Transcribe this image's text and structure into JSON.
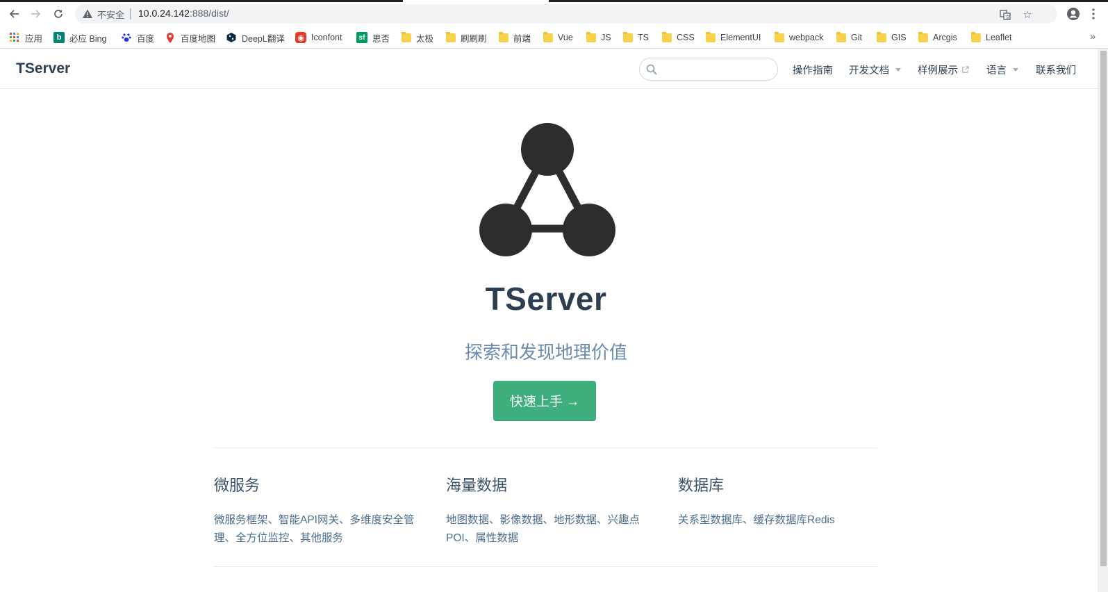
{
  "browser": {
    "security_label": "不安全",
    "url_host": "10.0.24.142",
    "url_path": ":888/dist/",
    "bookmarks": [
      {
        "label": "应用",
        "icon": "apps-grid-icon"
      },
      {
        "label": "必应 Bing",
        "icon": "bing-icon"
      },
      {
        "label": "百度",
        "icon": "baidu-paw-icon"
      },
      {
        "label": "百度地图",
        "icon": "map-pin-icon"
      },
      {
        "label": "DeepL翻译",
        "icon": "deepl-icon"
      },
      {
        "label": "Iconfont",
        "icon": "iconfont-icon"
      },
      {
        "label": "思否",
        "icon": "segmentfault-icon"
      },
      {
        "label": "太极",
        "icon": "folder-icon"
      },
      {
        "label": "刷刷刷",
        "icon": "folder-icon"
      },
      {
        "label": "前端",
        "icon": "folder-icon"
      },
      {
        "label": "Vue",
        "icon": "folder-icon"
      },
      {
        "label": "JS",
        "icon": "folder-icon"
      },
      {
        "label": "TS",
        "icon": "folder-icon"
      },
      {
        "label": "CSS",
        "icon": "folder-icon"
      },
      {
        "label": "ElementUI",
        "icon": "folder-icon"
      },
      {
        "label": "webpack",
        "icon": "folder-icon"
      },
      {
        "label": "Git",
        "icon": "folder-icon"
      },
      {
        "label": "GIS",
        "icon": "folder-icon"
      },
      {
        "label": "Arcgis",
        "icon": "folder-icon"
      },
      {
        "label": "Leaflet",
        "icon": "folder-icon"
      }
    ],
    "more_bookmarks": "»"
  },
  "navbar": {
    "brand": "TServer",
    "search_placeholder": "",
    "links": [
      {
        "label": "操作指南",
        "dropdown": false,
        "external": false
      },
      {
        "label": "开发文档",
        "dropdown": true,
        "external": false
      },
      {
        "label": "样例展示",
        "dropdown": false,
        "external": true
      },
      {
        "label": "语言",
        "dropdown": true,
        "external": false
      },
      {
        "label": "联系我们",
        "dropdown": false,
        "external": false
      }
    ]
  },
  "hero": {
    "title": "TServer",
    "tagline": "探索和发现地理价值",
    "cta_label": "快速上手 →",
    "accent_color": "#3eaf7c"
  },
  "features": [
    {
      "title": "微服务",
      "details": "微服务框架、智能API网关、多维度安全管理、全方位监控、其他服务"
    },
    {
      "title": "海量数据",
      "details": "地图数据、影像数据、地形数据、兴趣点POI、属性数据"
    },
    {
      "title": "数据库",
      "details": "关系型数据库、缓存数据库Redis"
    }
  ]
}
